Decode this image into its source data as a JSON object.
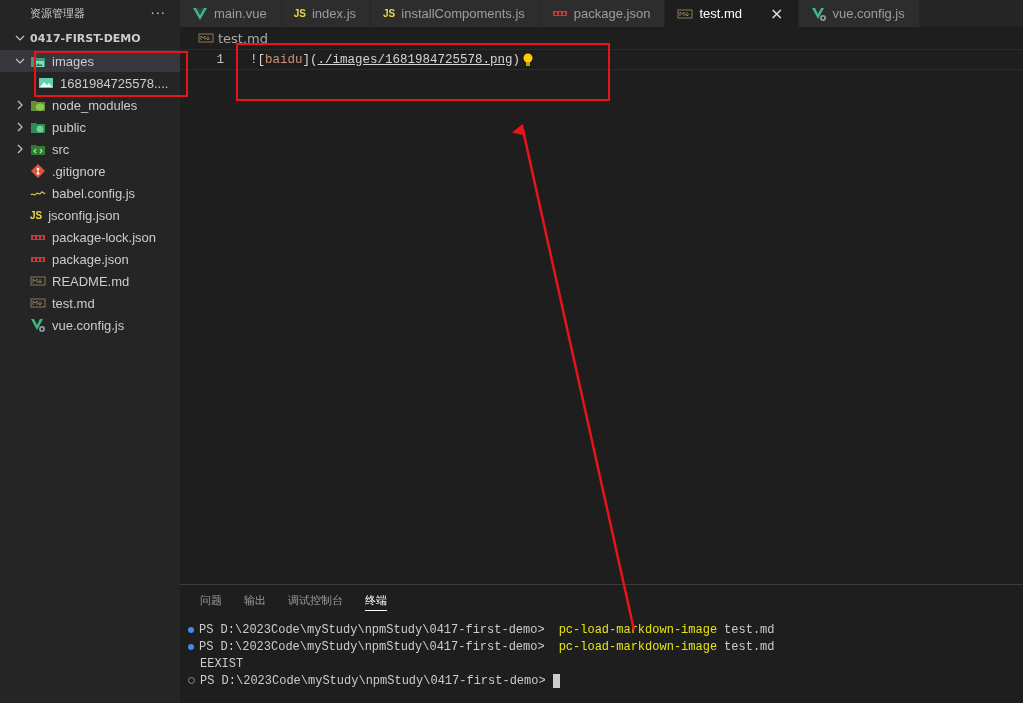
{
  "sidebar": {
    "title": "资源管理器",
    "more": "···",
    "root": {
      "label": "0417-FIRST-DEMO",
      "expanded": true
    },
    "items": [
      {
        "label": "images",
        "kind": "image-folder",
        "expanded": true,
        "selected": true,
        "children": [
          {
            "label": "1681984725578....",
            "kind": "image",
            "selected": false
          }
        ]
      },
      {
        "label": "node_modules",
        "kind": "node-folder",
        "expanded": false,
        "selected": false
      },
      {
        "label": "public",
        "kind": "public-folder",
        "expanded": false,
        "selected": false
      },
      {
        "label": "src",
        "kind": "src-folder",
        "expanded": false,
        "selected": false
      },
      {
        "label": ".gitignore",
        "kind": "git",
        "selected": false
      },
      {
        "label": "babel.config.js",
        "kind": "babel",
        "selected": false
      },
      {
        "label": "jsconfig.json",
        "kind": "js",
        "icon_text": "JS",
        "selected": false
      },
      {
        "label": "package-lock.json",
        "kind": "npm",
        "selected": false
      },
      {
        "label": "package.json",
        "kind": "npm",
        "selected": false
      },
      {
        "label": "README.md",
        "kind": "md",
        "selected": false
      },
      {
        "label": "test.md",
        "kind": "md",
        "selected": false
      },
      {
        "label": "vue.config.js",
        "kind": "vue-config",
        "selected": false
      }
    ]
  },
  "tabs": [
    {
      "label": "main.vue",
      "kind": "vue",
      "selected": false
    },
    {
      "label": "index.js",
      "kind": "js",
      "icon_text": "JS",
      "selected": false
    },
    {
      "label": "installCompoments.js",
      "kind": "js",
      "icon_text": "JS",
      "selected": false
    },
    {
      "label": "package.json",
      "kind": "npm",
      "selected": false
    },
    {
      "label": "test.md",
      "kind": "md",
      "selected": true,
      "close": "×"
    },
    {
      "label": "vue.config.js",
      "kind": "vue-config",
      "selected": false
    }
  ],
  "breadcrumb": {
    "label": "test.md",
    "kind": "md"
  },
  "editor": {
    "lines": [
      {
        "number": "1",
        "tokens": [
          {
            "kind": "punct",
            "text": "!["
          },
          {
            "kind": "alt",
            "text": "baidu"
          },
          {
            "kind": "punct",
            "text": "]("
          },
          {
            "kind": "link",
            "text": "./images/1681984725578.png"
          },
          {
            "kind": "punct",
            "text": ")"
          }
        ],
        "lightbulb": true
      }
    ]
  },
  "panel": {
    "tabs": [
      {
        "label": "问题",
        "selected": false
      },
      {
        "label": "输出",
        "selected": false
      },
      {
        "label": "调试控制台",
        "selected": false
      },
      {
        "label": "终端",
        "selected": true
      }
    ],
    "terminal": [
      {
        "kind": "command",
        "success": true,
        "prompt": "PS D:\\2023Code\\myStudy\\npmStudy\\0417-first-demo>",
        "command": "pc-load-markdown-image",
        "args": "test.md"
      },
      {
        "kind": "command",
        "success": true,
        "prompt": "PS D:\\2023Code\\myStudy\\npmStudy\\0417-first-demo>",
        "command": "pc-load-markdown-image",
        "args": "test.md"
      },
      {
        "kind": "output",
        "text": "EEXIST"
      },
      {
        "kind": "prompt",
        "success": false,
        "prompt": "PS D:\\2023Code\\myStudy\\npmStudy\\0417-first-demo>",
        "cursor": true
      }
    ]
  }
}
